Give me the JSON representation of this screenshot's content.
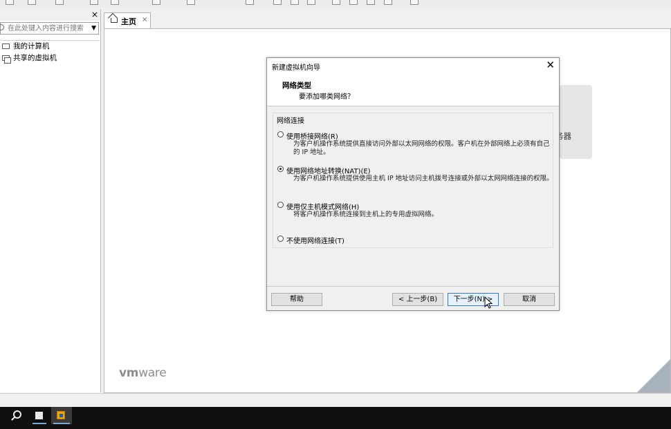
{
  "sidebar": {
    "close_glyph": "×",
    "search_placeholder": "在此处键入内容进行搜索",
    "dropdown_glyph": "▼",
    "tree": [
      {
        "label": "我的计算机",
        "icon": "computer-icon"
      },
      {
        "label": "共享的虚拟机",
        "icon": "shared-vm-icon"
      }
    ]
  },
  "tabs": [
    {
      "label": "主页",
      "close_glyph": "×",
      "icon": "home-icon"
    }
  ],
  "main": {
    "logo_text_bold": "vm",
    "logo_text_rest": "ware",
    "behind_card_text": "务器"
  },
  "dialog": {
    "title": "新建虚拟机向导",
    "close_glyph": "✕",
    "heading": "网络类型",
    "subheading": "要添加哪类网络？",
    "group_title": "网络连接",
    "options": [
      {
        "label": "使用桥接网络(R)",
        "desc": "为客户机操作系统提供直接访问外部以太网网络的权限。客户机在外部网络上必须有自己的 IP 地址。",
        "selected": false
      },
      {
        "label": "使用网络地址转换(NAT)(E)",
        "desc": "为客户机操作系统提供使用主机 IP 地址访问主机拨号连接或外部以太网网络连接的权限。",
        "selected": true
      },
      {
        "label": "使用仅主机模式网络(H)",
        "desc": "将客户机操作系统连接到主机上的专用虚拟网络。",
        "selected": false
      },
      {
        "label": "不使用网络连接(T)",
        "desc": "",
        "selected": false
      }
    ],
    "buttons": {
      "help": "帮助",
      "back": "< 上一步(B)",
      "next": "下一步(N) >",
      "cancel": "取消"
    }
  },
  "colors": {
    "accent_focus": "#2a7ad6",
    "taskbar": "#101010",
    "vmware_logo": "#8d8d8d"
  }
}
